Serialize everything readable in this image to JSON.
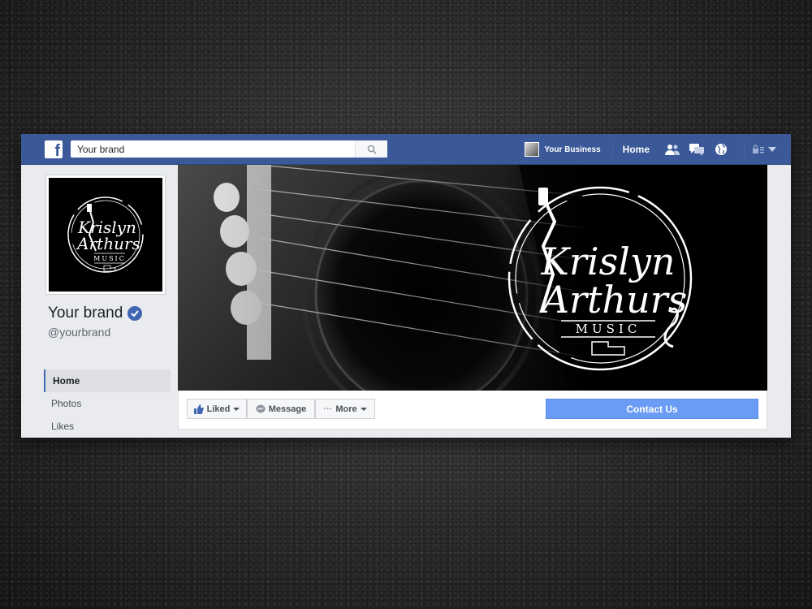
{
  "topbar": {
    "search_value": "Your brand",
    "user_name": "Your Business",
    "home_label": "Home",
    "icons": [
      "friends-icon",
      "messages-icon",
      "globe-icon",
      "lock-icon",
      "dropdown-icon"
    ]
  },
  "profile": {
    "name": "Your brand",
    "handle": "@yourbrand",
    "verified": true
  },
  "side_nav": {
    "items": [
      {
        "label": "Home"
      },
      {
        "label": "Photos"
      },
      {
        "label": "Likes"
      }
    ]
  },
  "logo": {
    "line1": "Krislyn",
    "line2": "Arthurs",
    "line3": "MUSIC"
  },
  "actions": {
    "liked": "Liked",
    "message": "Message",
    "more": "More",
    "contact": "Contact Us"
  },
  "colors": {
    "facebook_blue": "#3b5998",
    "contact_button": "#6a9cf5",
    "verified_badge": "#4267b2"
  }
}
